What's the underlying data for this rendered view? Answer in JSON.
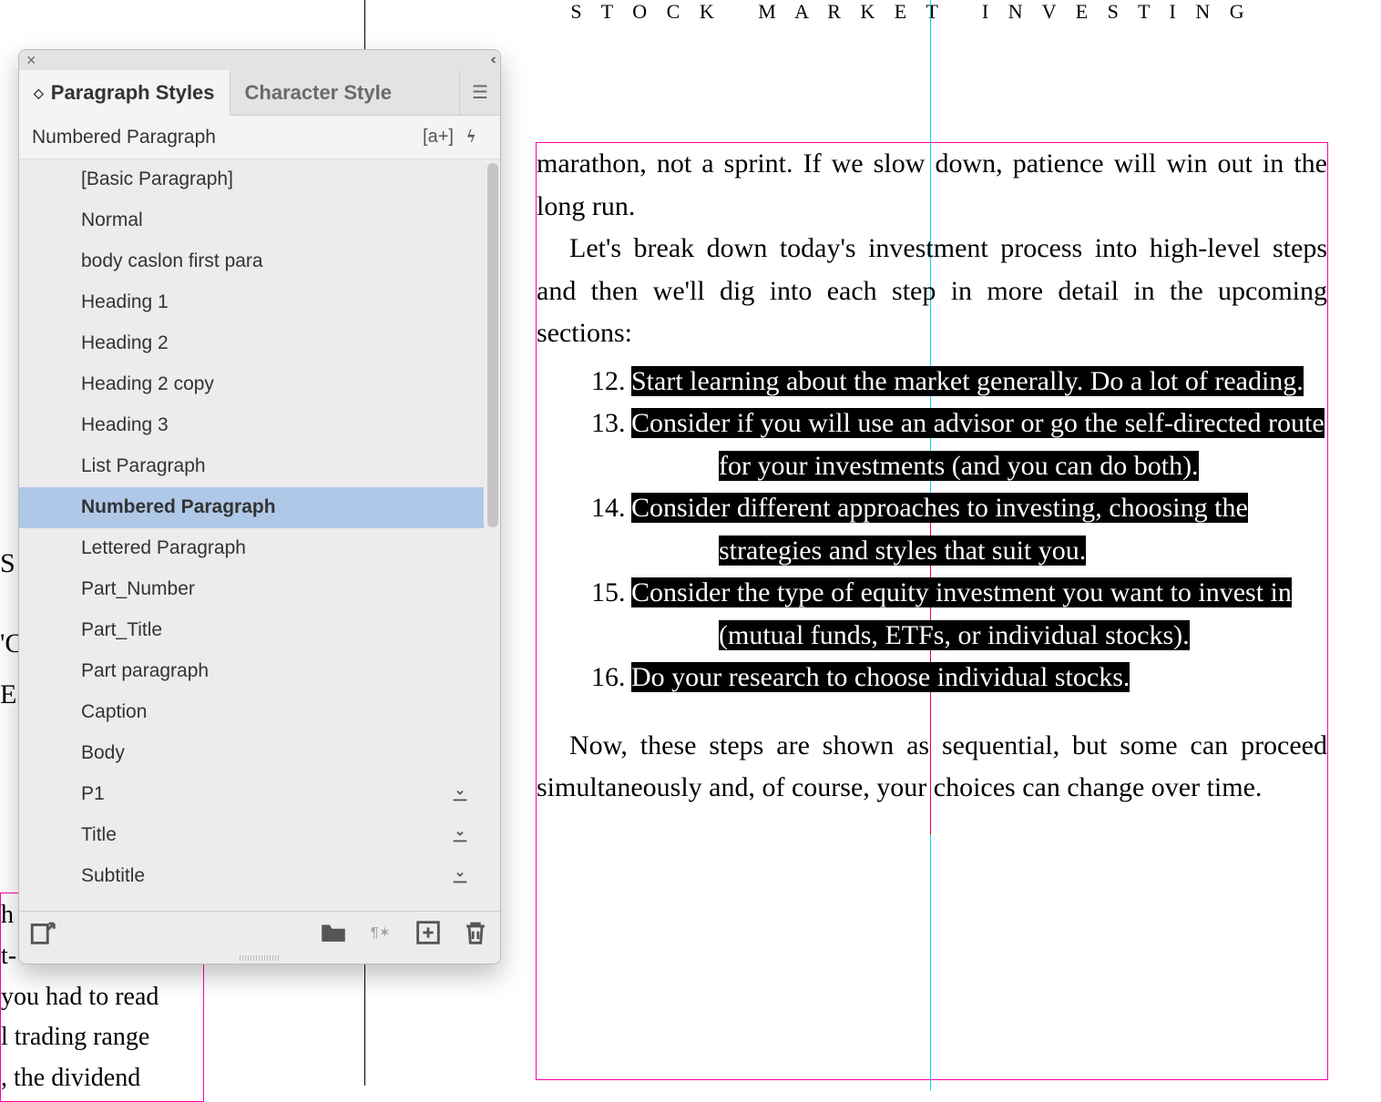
{
  "header_title": "S T O C K   M A R K E T   I N V E S T I N G",
  "left_peek": [
    "S",
    "'C",
    "E"
  ],
  "left_bottom": [
    "h",
    "t-",
    "you had to read",
    "l trading range",
    ", the dividend"
  ],
  "panel": {
    "tab_active": "Paragraph Styles",
    "tab_inactive": "Character Style",
    "current_style": "Numbered Paragraph",
    "override_label": "[a+]",
    "styles": [
      {
        "name": "[Basic Paragraph]",
        "download": false
      },
      {
        "name": "Normal",
        "download": false
      },
      {
        "name": "body caslon first para",
        "download": false
      },
      {
        "name": "Heading 1",
        "download": false
      },
      {
        "name": "Heading 2",
        "download": false
      },
      {
        "name": "Heading 2 copy",
        "download": false
      },
      {
        "name": "Heading 3",
        "download": false
      },
      {
        "name": "List Paragraph",
        "download": false
      },
      {
        "name": "Numbered Paragraph",
        "download": false,
        "selected": true
      },
      {
        "name": "Lettered Paragraph",
        "download": false
      },
      {
        "name": "Part_Number",
        "download": false
      },
      {
        "name": "Part_Title",
        "download": false
      },
      {
        "name": "Part paragraph",
        "download": false
      },
      {
        "name": "Caption",
        "download": false
      },
      {
        "name": "Body",
        "download": false
      },
      {
        "name": "P1",
        "download": true
      },
      {
        "name": "Title",
        "download": true
      },
      {
        "name": "Subtitle",
        "download": true
      }
    ]
  },
  "body": {
    "p1": "marathon, not a sprint. If we slow down, patience will win out in the long run.",
    "p2": "Let's break down today's investment process into high-level steps and then we'll dig into each step in more detail in the upcoming sections:",
    "items": [
      {
        "num": "12.",
        "text": "Start learning about the market generally. Do a lot of reading."
      },
      {
        "num": "13.",
        "text": "Consider if you will use an advisor or go the self-directed route for your investments (and you can do both)."
      },
      {
        "num": "14.",
        "text": "Consider different approaches to investing, choosing the strategies and styles that suit you."
      },
      {
        "num": "15.",
        "text": "Consider the type of equity investment you want to invest in (mutual funds, ETFs, or individual stocks)."
      },
      {
        "num": "16.",
        "text": "Do your research to choose individual stocks."
      }
    ],
    "p3": "Now, these steps are shown as sequential, but some can proceed simultaneously and, of course, your choices can change over time."
  }
}
